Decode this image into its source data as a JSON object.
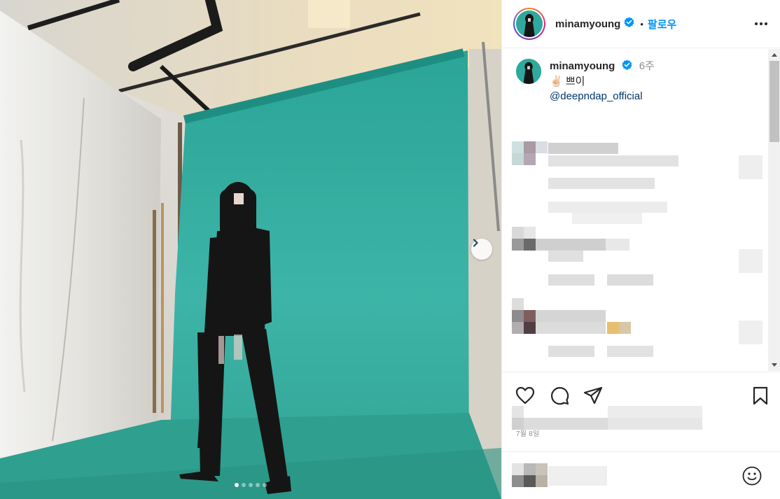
{
  "post": {
    "username": "minamyoung",
    "separator": "•",
    "follow_label": "팔로우",
    "caption_time": "6주",
    "caption_emoji": "✌🏻",
    "caption_text": "쁘이",
    "caption_mention": "@deepndap_official",
    "date": "7월 8일",
    "carousel_count": 5,
    "carousel_active_index": 0
  },
  "icons": {
    "verified": "verified-badge-icon",
    "more": "more-options-icon",
    "next": "chevron-right-icon",
    "like": "heart-icon",
    "comment": "comment-bubble-icon",
    "share": "paper-plane-icon",
    "save": "bookmark-icon",
    "emoji": "emoji-smile-icon"
  },
  "colors": {
    "accent": "#0095f6",
    "verified": "#0095f6",
    "backdrop": "#2fa89d",
    "mention": "#00376b"
  }
}
